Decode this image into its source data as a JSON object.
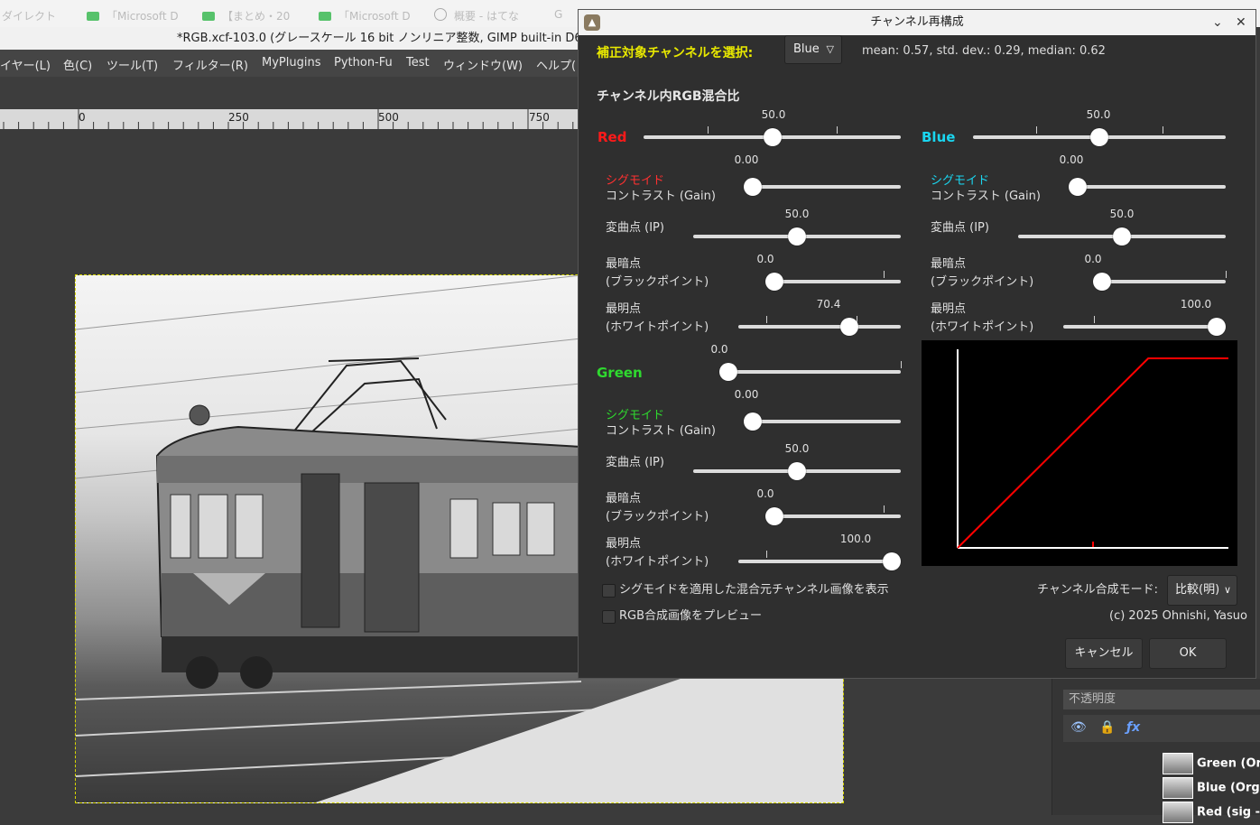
{
  "browser_tabs": [
    {
      "label": "ダイレクト",
      "icon": "none"
    },
    {
      "label": "「Microsoft D",
      "icon": "edge-icon"
    },
    {
      "label": "【まとめ・20",
      "icon": "edge-icon"
    },
    {
      "label": "「Microsoft D",
      "icon": "edge-icon"
    },
    {
      "label": "概要 - はてな",
      "icon": "info-icon"
    },
    {
      "label": "G",
      "icon": "none"
    }
  ],
  "gimp": {
    "title": "*RGB.xcf-103.0 (グレースケール 16 bit ノンリニア整数, GIMP built-in D65 Gr",
    "menu": [
      "イヤー(L)",
      "色(C)",
      "ツール(T)",
      "フィルター(R)",
      "MyPlugins",
      "Python-Fu",
      "Test",
      "ウィンドウ(W)",
      "ヘルプ("
    ],
    "ruler_labels": [
      "0",
      "250",
      "500",
      "750"
    ],
    "opacity_label": "不透明度",
    "layers": [
      "Green (Org",
      "Blue (Org -",
      "Red (sig - R"
    ]
  },
  "dialog": {
    "title": "チャンネル再構成",
    "target_label": "補正対象チャンネルを選択:",
    "target_value": "Blue",
    "stats": "mean: 0.57, std. dev.: 0.29, median: 0.62",
    "mix_heading": "チャンネル内RGB混合比",
    "red": {
      "name": "Red",
      "value": "50.0",
      "value_num": 50.0,
      "sigmoid": "シグモイド",
      "contrast_label": "コントラスト (Gain)",
      "contrast": "0.00",
      "contrast_num": 0.0,
      "ip_label": "変曲点 (IP)",
      "ip": "50.0",
      "ip_num": 50.0,
      "black_label1": "最暗点",
      "black_label2": "(ブラックポイント)",
      "black": "0.0",
      "black_num": 0.0,
      "white_label1": "最明点",
      "white_label2": "(ホワイトポイント)",
      "white": "70.4",
      "white_num": 70.4
    },
    "green": {
      "name": "Green",
      "value": "0.0",
      "value_num": 0.0,
      "sigmoid": "シグモイド",
      "contrast_label": "コントラスト (Gain)",
      "contrast": "0.00",
      "contrast_num": 0.0,
      "ip_label": "変曲点 (IP)",
      "ip": "50.0",
      "ip_num": 50.0,
      "black_label1": "最暗点",
      "black_label2": "(ブラックポイント)",
      "black": "0.0",
      "black_num": 0.0,
      "white_label1": "最明点",
      "white_label2": "(ホワイトポイント)",
      "white": "100.0",
      "white_num": 100.0
    },
    "blue": {
      "name": "Blue",
      "value": "50.0",
      "value_num": 50.0,
      "sigmoid": "シグモイド",
      "contrast_label": "コントラスト (Gain)",
      "contrast": "0.00",
      "contrast_num": 0.0,
      "ip_label": "変曲点 (IP)",
      "ip": "50.0",
      "ip_num": 50.0,
      "black_label1": "最暗点",
      "black_label2": "(ブラックポイント)",
      "black": "0.0",
      "black_num": 0.0,
      "white_label1": "最明点",
      "white_label2": "(ホワイトポイント)",
      "white": "100.0",
      "white_num": 100.0
    },
    "show_sigmoid_label": "シグモイドを適用した混合元チャンネル画像を表示",
    "preview_label": "RGB合成画像をプレビュー",
    "mode_label": "チャンネル合成モード:",
    "mode_value": "比較(明)",
    "copyright": "(c) 2025 Ohnishi, Yasuo",
    "cancel_label": "キャンセル",
    "ok_label": "OK",
    "colors": {
      "red": "#ff1a1a",
      "green": "#2fd92f",
      "blue": "#1ad6f0",
      "target": "#e8e800",
      "curve": "#ff0000"
    },
    "curve": {
      "black_point": 0.0,
      "white_point": 70.4
    }
  }
}
